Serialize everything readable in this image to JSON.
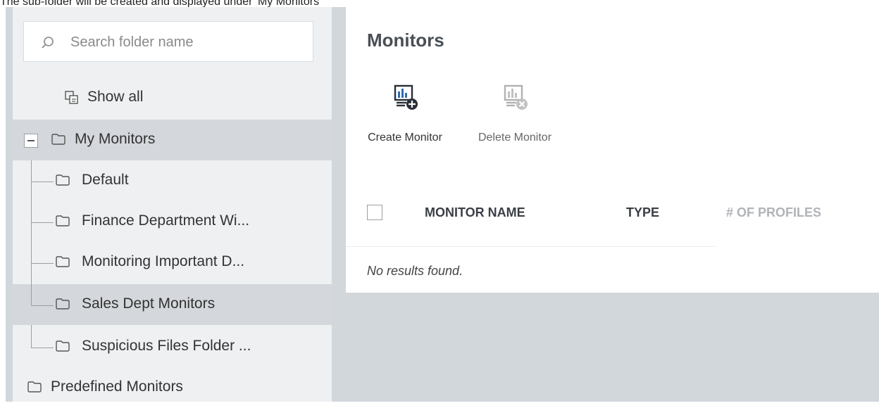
{
  "caption": "The sub-folder will be created and displayed under 'My Monitors'",
  "sidebar": {
    "search_placeholder": "Search folder name",
    "show_all_label": "Show all",
    "root": {
      "label": "My Monitors"
    },
    "children": [
      {
        "label": "Default"
      },
      {
        "label": "Finance Department Wi..."
      },
      {
        "label": "Monitoring Important D..."
      },
      {
        "label": "Sales Dept Monitors"
      },
      {
        "label": "Suspicious Files Folder ..."
      }
    ],
    "predefined": {
      "label": "Predefined Monitors"
    }
  },
  "main": {
    "title": "Monitors",
    "toolbar": {
      "create_label": "Create Monitor",
      "delete_label": "Delete Monitor"
    },
    "table": {
      "columns": [
        "MONITOR NAME",
        "TYPE",
        "# OF PROFILES"
      ],
      "empty_text": "No results found."
    }
  },
  "colors": {
    "accent": "#2e6db4",
    "selected_row": "#d4d7db",
    "sidebar_bg": "#eef0f2"
  }
}
